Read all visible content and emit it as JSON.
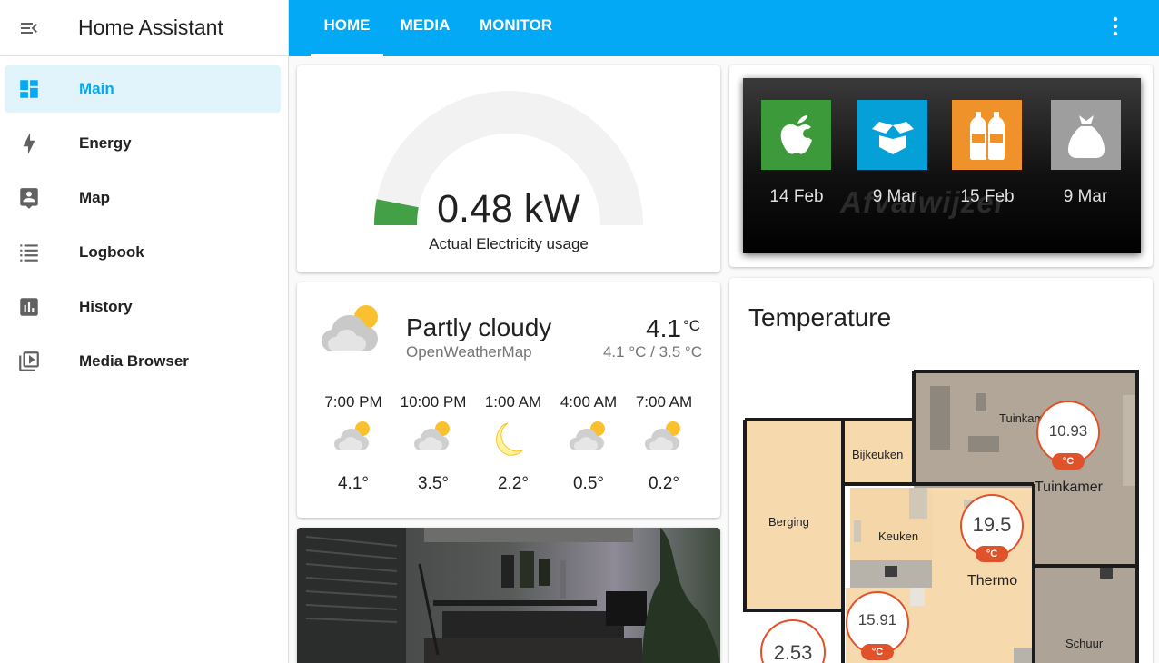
{
  "app": {
    "title": "Home Assistant"
  },
  "sidebar": {
    "items": [
      {
        "label": "Main",
        "icon": "dashboard-icon",
        "active": true
      },
      {
        "label": "Energy",
        "icon": "lightning-icon"
      },
      {
        "label": "Map",
        "icon": "map-account-icon"
      },
      {
        "label": "Logbook",
        "icon": "logbook-icon"
      },
      {
        "label": "History",
        "icon": "chart-bar-icon"
      },
      {
        "label": "Media Browser",
        "icon": "play-box-multiple-icon"
      }
    ]
  },
  "header": {
    "tabs": [
      {
        "label": "HOME",
        "active": true
      },
      {
        "label": "MEDIA"
      },
      {
        "label": "MONITOR"
      }
    ],
    "menu_icon": "dots-vertical-icon"
  },
  "gauge": {
    "value": "0.48 kW",
    "label": "Actual Electricity usage",
    "fill_fraction": 0.04,
    "color": "#43a047"
  },
  "waste": {
    "watermark": "Afvalwijzer",
    "items": [
      {
        "type": "gft",
        "icon": "apple-icon",
        "color": "#3d9a3b",
        "date": "14 Feb"
      },
      {
        "type": "papier",
        "icon": "box-icon",
        "color": "#06a0d8",
        "date": "9 Mar"
      },
      {
        "type": "pmd",
        "icon": "bottles-icon",
        "color": "#f0922a",
        "date": "15 Feb"
      },
      {
        "type": "restafval",
        "icon": "bag-icon",
        "color": "#9e9e9e",
        "date": "9 Mar"
      }
    ]
  },
  "weather": {
    "condition": "Partly cloudy",
    "source": "OpenWeatherMap",
    "temperature": "4.1",
    "unit": "°C",
    "hi_lo": "4.1 °C / 3.5 °C",
    "forecast": [
      {
        "time": "7:00 PM",
        "icon": "partly-cloudy-icon",
        "temp": "4.1°"
      },
      {
        "time": "10:00 PM",
        "icon": "partly-cloudy-icon",
        "temp": "3.5°"
      },
      {
        "time": "1:00 AM",
        "icon": "moon-icon",
        "temp": "2.2°"
      },
      {
        "time": "4:00 AM",
        "icon": "partly-cloudy-icon",
        "temp": "0.5°"
      },
      {
        "time": "7:00 AM",
        "icon": "partly-cloudy-icon",
        "temp": "0.2°"
      }
    ]
  },
  "temperature_card": {
    "title": "Temperature",
    "rooms": [
      "Tuinkamer",
      "Bijkeuken",
      "Berging",
      "Keuken",
      "Schuur"
    ],
    "sensors": [
      {
        "value": "10.93",
        "unit": "°C",
        "name": "Tuinkamer"
      },
      {
        "value": "19.5",
        "unit": "°C",
        "name": "Thermo"
      },
      {
        "value": "15.91",
        "unit": "°C",
        "name": ""
      },
      {
        "value": "2.53",
        "unit": "",
        "name": ""
      }
    ]
  }
}
